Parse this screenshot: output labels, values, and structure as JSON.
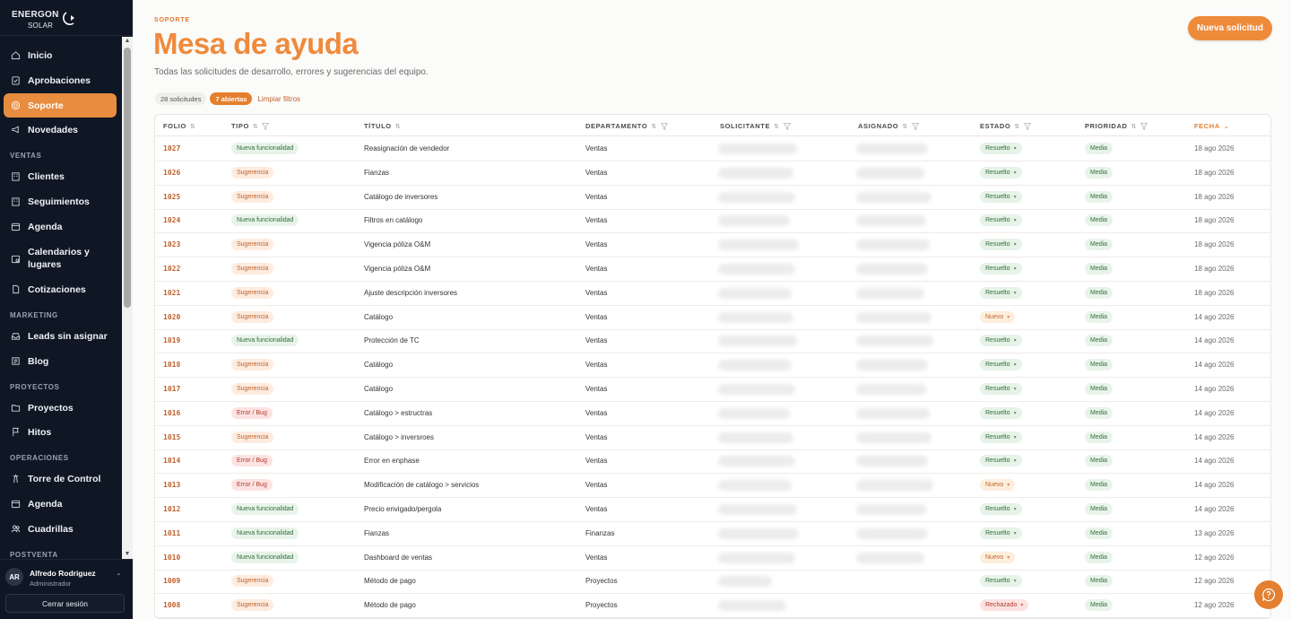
{
  "brand": {
    "name": "ENERGON",
    "sub": "SOLAR"
  },
  "sidebar": {
    "items": [
      {
        "label": "Inicio",
        "icon": "home-icon",
        "active": false
      },
      {
        "label": "Aprobaciones",
        "icon": "clipboard-icon",
        "active": false
      },
      {
        "label": "Soporte",
        "icon": "lifebuoy-icon",
        "active": true
      },
      {
        "label": "Novedades",
        "icon": "megaphone-icon",
        "active": false
      }
    ],
    "sections": [
      {
        "title": "VENTAS",
        "items": [
          {
            "label": "Clientes",
            "icon": "building-icon"
          },
          {
            "label": "Seguimientos",
            "icon": "building-icon"
          },
          {
            "label": "Agenda",
            "icon": "calendar-icon"
          },
          {
            "label": "Calendarios y lugares",
            "icon": "calendar-gear-icon"
          },
          {
            "label": "Cotizaciones",
            "icon": "document-icon"
          }
        ]
      },
      {
        "title": "MARKETING",
        "items": [
          {
            "label": "Leads sin asignar",
            "icon": "inbox-icon"
          },
          {
            "label": "Blog",
            "icon": "newspaper-icon"
          }
        ]
      },
      {
        "title": "PROYECTOS",
        "items": [
          {
            "label": "Proyectos",
            "icon": "folder-icon"
          },
          {
            "label": "Hitos",
            "icon": "flag-icon"
          }
        ]
      },
      {
        "title": "OPERACIONES",
        "items": [
          {
            "label": "Torre de Control",
            "icon": "tower-icon"
          },
          {
            "label": "Agenda",
            "icon": "calendar-icon"
          },
          {
            "label": "Cuadrillas",
            "icon": "team-icon"
          }
        ]
      },
      {
        "title": "POSTVENTA",
        "items": []
      }
    ]
  },
  "user": {
    "initials": "AR",
    "name": "Alfredo Rodriguez",
    "role": "Administrador",
    "logout_label": "Cerrar sesión"
  },
  "header": {
    "eyebrow": "SOPORTE",
    "title": "Mesa de ayuda",
    "subtitle": "Todas las solicitudes de desarrollo, errores y sugerencias del equipo.",
    "new_button": "Nueva solicitud"
  },
  "filters": {
    "count_label": "28 solicitudes",
    "open_label": "7 abiertas",
    "clear_label": "Limpiar filtros"
  },
  "table": {
    "columns": [
      "FOLIO",
      "TIPO",
      "TÍTULO",
      "DEPARTAMENTO",
      "SOLICITANTE",
      "ASIGNADO",
      "ESTADO",
      "PRIORIDAD",
      "FECHA"
    ],
    "rows": [
      {
        "folio": "1027",
        "tipo": "Nueva funcionalidad",
        "titulo": "Reasignación de vendedor",
        "depto": "Ventas",
        "estado": "Resuelto",
        "prioridad": "Media",
        "fecha": "18 ago 2026"
      },
      {
        "folio": "1026",
        "tipo": "Sugerencia",
        "titulo": "Fianzas",
        "depto": "Ventas",
        "estado": "Resuelto",
        "prioridad": "Media",
        "fecha": "18 ago 2026"
      },
      {
        "folio": "1025",
        "tipo": "Sugerencia",
        "titulo": "Catálogo de inversores",
        "depto": "Ventas",
        "estado": "Resuelto",
        "prioridad": "Media",
        "fecha": "18 ago 2026"
      },
      {
        "folio": "1024",
        "tipo": "Nueva funcionalidad",
        "titulo": "Filtros en catálogo",
        "depto": "Ventas",
        "estado": "Resuelto",
        "prioridad": "Media",
        "fecha": "18 ago 2026"
      },
      {
        "folio": "1023",
        "tipo": "Sugerencia",
        "titulo": "Vigencia póliza O&M",
        "depto": "Ventas",
        "estado": "Resuelto",
        "prioridad": "Media",
        "fecha": "18 ago 2026"
      },
      {
        "folio": "1022",
        "tipo": "Sugerencia",
        "titulo": "Vigencia póliza O&M",
        "depto": "Ventas",
        "estado": "Resuelto",
        "prioridad": "Media",
        "fecha": "18 ago 2026"
      },
      {
        "folio": "1021",
        "tipo": "Sugerencia",
        "titulo": "Ajuste descripción inversores",
        "depto": "Ventas",
        "estado": "Resuelto",
        "prioridad": "Media",
        "fecha": "18 ago 2026"
      },
      {
        "folio": "1020",
        "tipo": "Sugerencia",
        "titulo": "Catálogo",
        "depto": "Ventas",
        "estado": "Nuevo",
        "prioridad": "Media",
        "fecha": "14 ago 2026"
      },
      {
        "folio": "1019",
        "tipo": "Nueva funcionalidad",
        "titulo": "Protección de TC",
        "depto": "Ventas",
        "estado": "Resuelto",
        "prioridad": "Media",
        "fecha": "14 ago 2026"
      },
      {
        "folio": "1018",
        "tipo": "Sugerencia",
        "titulo": "Catálogo",
        "depto": "Ventas",
        "estado": "Resuelto",
        "prioridad": "Media",
        "fecha": "14 ago 2026"
      },
      {
        "folio": "1017",
        "tipo": "Sugerencia",
        "titulo": "Catálogo",
        "depto": "Ventas",
        "estado": "Resuelto",
        "prioridad": "Media",
        "fecha": "14 ago 2026"
      },
      {
        "folio": "1016",
        "tipo": "Error / Bug",
        "titulo": "Catálogo > estructras",
        "depto": "Ventas",
        "estado": "Resuelto",
        "prioridad": "Media",
        "fecha": "14 ago 2026"
      },
      {
        "folio": "1015",
        "tipo": "Sugerencia",
        "titulo": "Catálogo > inversroes",
        "depto": "Ventas",
        "estado": "Resuelto",
        "prioridad": "Media",
        "fecha": "14 ago 2026"
      },
      {
        "folio": "1014",
        "tipo": "Error / Bug",
        "titulo": "Error en enphase",
        "depto": "Ventas",
        "estado": "Resuelto",
        "prioridad": "Media",
        "fecha": "14 ago 2026"
      },
      {
        "folio": "1013",
        "tipo": "Error / Bug",
        "titulo": "Modificación de catálogo > servicios",
        "depto": "Ventas",
        "estado": "Nuevo",
        "prioridad": "Media",
        "fecha": "14 ago 2026"
      },
      {
        "folio": "1012",
        "tipo": "Nueva funcionalidad",
        "titulo": "Precio envigado/pergola",
        "depto": "Ventas",
        "estado": "Resuelto",
        "prioridad": "Media",
        "fecha": "14 ago 2026"
      },
      {
        "folio": "1011",
        "tipo": "Nueva funcionalidad",
        "titulo": "Fianzas",
        "depto": "Finanzas",
        "estado": "Resuelto",
        "prioridad": "Media",
        "fecha": "13 ago 2026"
      },
      {
        "folio": "1010",
        "tipo": "Nueva funcionalidad",
        "titulo": "Dashboard de ventas",
        "depto": "Ventas",
        "estado": "Nuevo",
        "prioridad": "Media",
        "fecha": "12 ago 2026"
      },
      {
        "folio": "1009",
        "tipo": "Sugerencia",
        "titulo": "Método de pago",
        "depto": "Proyectos",
        "estado": "Resuelto",
        "prioridad": "Media",
        "fecha": "12 ago 2026"
      },
      {
        "folio": "1008",
        "tipo": "Sugerencia",
        "titulo": "Método de pago",
        "depto": "Proyectos",
        "estado": "Rechazado",
        "prioridad": "Media",
        "fecha": "12 ago 2026"
      }
    ]
  },
  "colors": {
    "accent": "#ee8b3a",
    "sidebar_bg": "#0f1624",
    "folio": "#c1612b"
  }
}
